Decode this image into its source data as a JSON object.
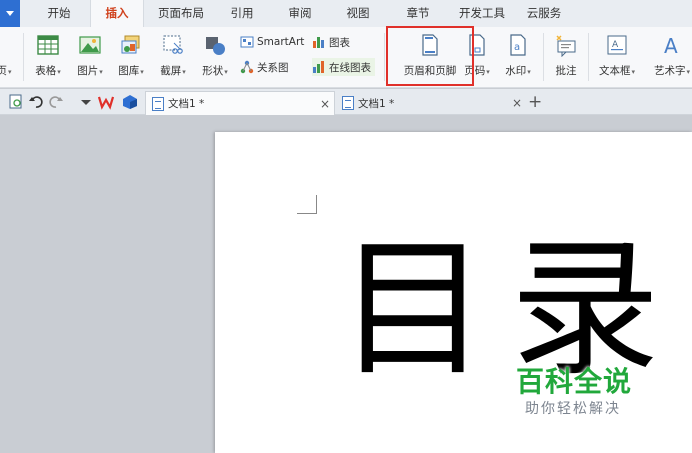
{
  "tabs": [
    {
      "label": "开始",
      "active": false
    },
    {
      "label": "插入",
      "active": true
    },
    {
      "label": "页面布局",
      "active": false
    },
    {
      "label": "引用",
      "active": false
    },
    {
      "label": "审阅",
      "active": false
    },
    {
      "label": "视图",
      "active": false
    },
    {
      "label": "章节",
      "active": false
    },
    {
      "label": "开发工具",
      "active": false
    },
    {
      "label": "云服务",
      "active": false
    }
  ],
  "ribbon": {
    "cut_label": "页",
    "table": "表格",
    "picture": "图片",
    "gallery": "图库",
    "screenshot": "截屏",
    "shapes": "形状",
    "smartart": "SmartArt",
    "chart": "图表",
    "relation": "关系图",
    "online_chart": "在线图表",
    "header_footer": "页眉和页脚",
    "page_number": "页码",
    "watermark": "水印",
    "comment": "批注",
    "textbox": "文本框",
    "wordart": "艺术字",
    "dropdown_arrow": "▾"
  },
  "doc_tabs": [
    {
      "label": "文档1 *",
      "active": true
    },
    {
      "label": "文档1 *",
      "active": false
    }
  ],
  "close_glyph": "×",
  "plus_glyph": "+",
  "document": {
    "title": "目录"
  },
  "watermark": {
    "main": "百科全说",
    "sub": "助你轻松解决"
  },
  "colors": {
    "active_tab": "#d0411c",
    "highlight_box": "#e0302a",
    "watermark_green": "#21a83b"
  }
}
